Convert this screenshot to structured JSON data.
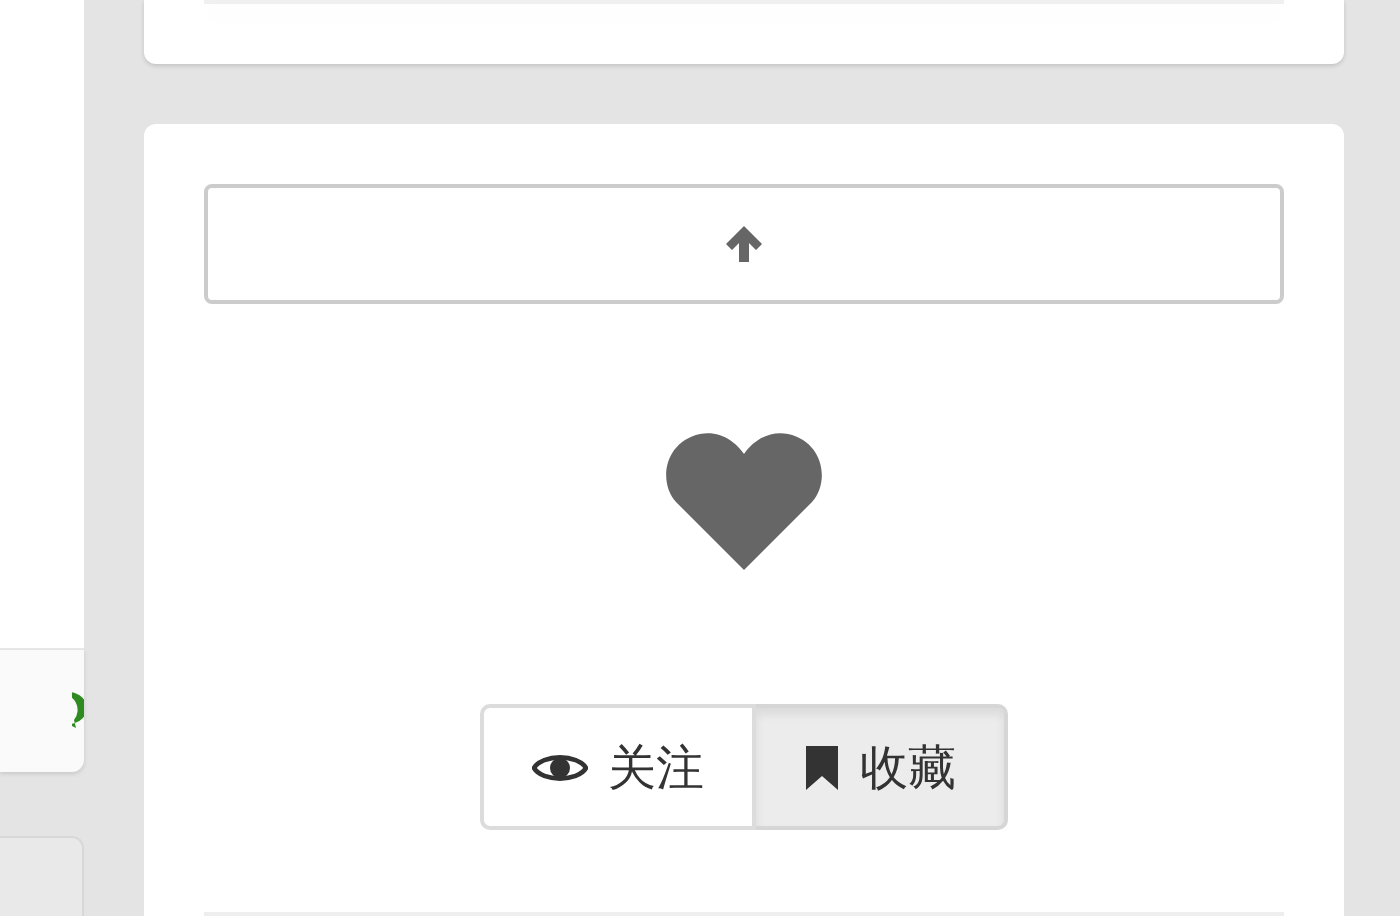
{
  "like": {
    "liked": false
  },
  "actions": [
    {
      "kind": "follow",
      "label": "关注",
      "selected": false
    },
    {
      "kind": "bookmark",
      "label": "收藏",
      "selected": true
    }
  ]
}
